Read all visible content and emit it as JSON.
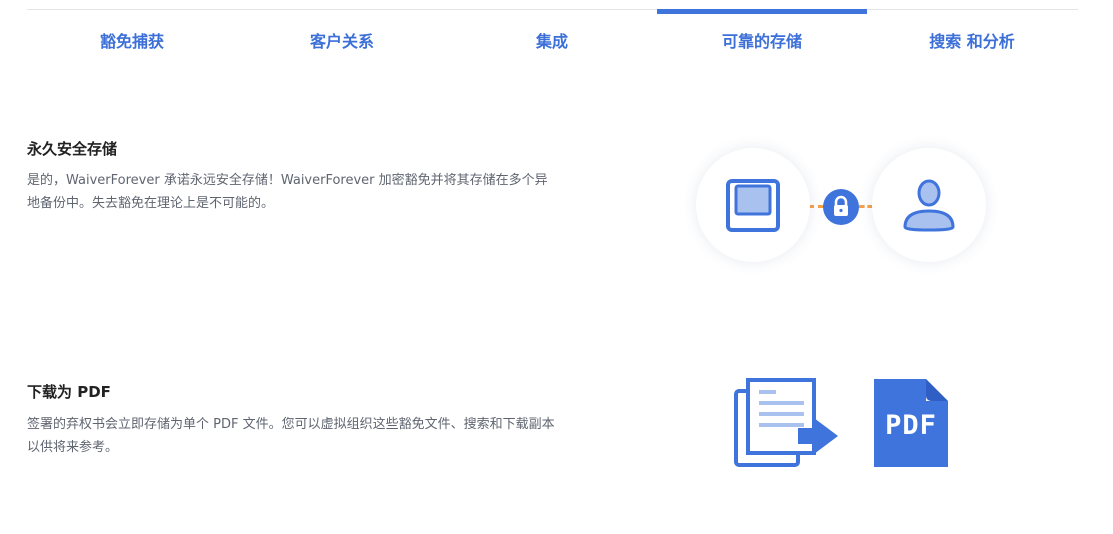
{
  "tabs": [
    {
      "label": "豁免捕获"
    },
    {
      "label": "客户关系"
    },
    {
      "label": "集成"
    },
    {
      "label": "可靠的存储"
    },
    {
      "label": "搜索 和分析"
    }
  ],
  "active_tab": "可靠的存储",
  "sections": [
    {
      "title": "永久安全存储",
      "description": "是的，WaiverForever 承诺永远安全存储！WaiverForever 加密豁免并将其存储在多个异地备份中。失去豁免在理论上是不可能的。",
      "icons": [
        "floppy-disk-icon",
        "lock-icon",
        "user-icon"
      ]
    },
    {
      "title": "下载为 PDF",
      "description": "签署的弃权书会立即存储为单个 PDF 文件。您可以虚拟组织这些豁免文件、搜索和下载副本以供将来参考。",
      "icons": [
        "documents-export-icon",
        "pdf-file-icon"
      ],
      "pdf_label": "PDF"
    }
  ],
  "colors": {
    "accent": "#3f74dc",
    "tab_text": "#3c70d8",
    "dash": "#f5a14a"
  }
}
